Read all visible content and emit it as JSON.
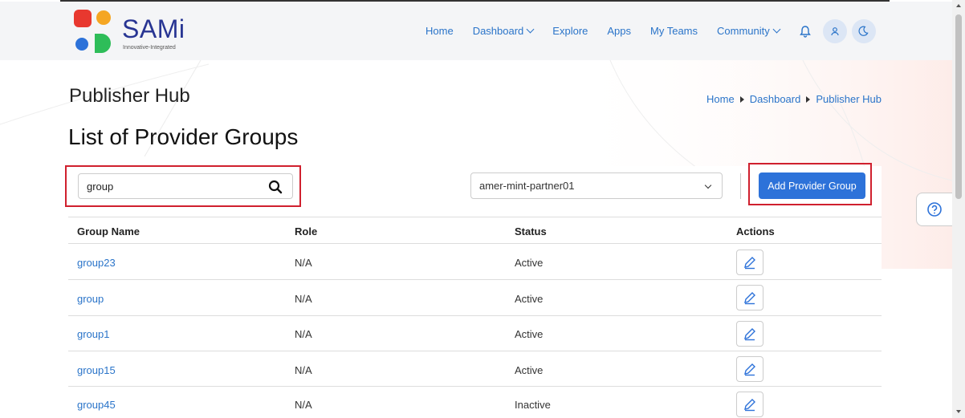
{
  "brand": {
    "name": "SAMi",
    "tagline": "Innovative-Integrated",
    "colors": {
      "red": "#e8382f",
      "orange": "#f5a623",
      "blue": "#2d72d9",
      "green": "#2ebd59"
    }
  },
  "nav": {
    "items": [
      {
        "label": "Home",
        "has_dropdown": false
      },
      {
        "label": "Dashboard",
        "has_dropdown": true
      },
      {
        "label": "Explore",
        "has_dropdown": false
      },
      {
        "label": "Apps",
        "has_dropdown": false
      },
      {
        "label": "My Teams",
        "has_dropdown": false
      },
      {
        "label": "Community",
        "has_dropdown": true
      }
    ],
    "icons": [
      "bell-icon",
      "user-icon",
      "moon-icon"
    ]
  },
  "page": {
    "title": "Publisher Hub",
    "section_title": "List of Provider Groups"
  },
  "breadcrumb": [
    "Home",
    "Dashboard",
    "Publisher Hub"
  ],
  "search": {
    "value": "group",
    "icon": "search-icon"
  },
  "partner_select": {
    "selected": "amer-mint-partner01"
  },
  "add_button_label": "Add Provider Group",
  "table": {
    "columns": [
      "Group Name",
      "Role",
      "Status",
      "Actions"
    ],
    "rows": [
      {
        "name": "group23",
        "role": "N/A",
        "status": "Active"
      },
      {
        "name": "group",
        "role": "N/A",
        "status": "Active"
      },
      {
        "name": "group1",
        "role": "N/A",
        "status": "Active"
      },
      {
        "name": "group15",
        "role": "N/A",
        "status": "Active"
      },
      {
        "name": "group45",
        "role": "N/A",
        "status": "Inactive"
      }
    ]
  },
  "accent_color": "#2d72d9",
  "highlight_color": "#d0202e"
}
